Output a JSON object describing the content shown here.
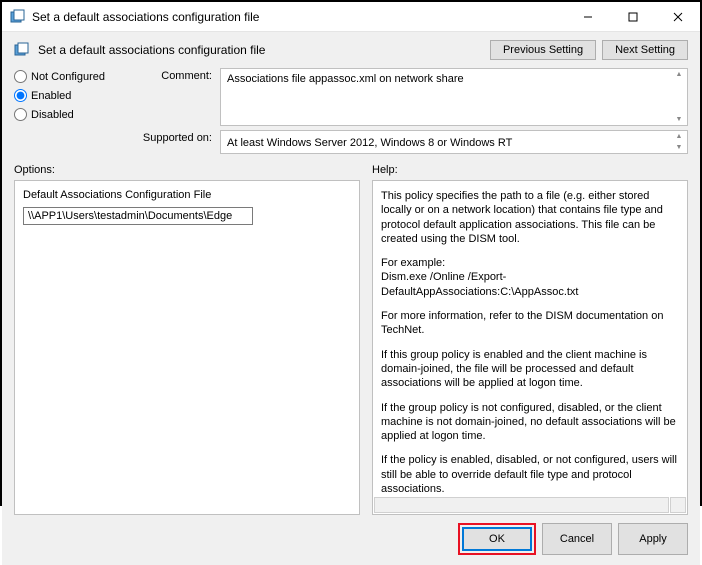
{
  "window": {
    "title": "Set a default associations configuration file"
  },
  "header": {
    "title": "Set a default associations configuration file",
    "prev_button": "Previous Setting",
    "next_button": "Next Setting"
  },
  "state": {
    "not_configured": "Not Configured",
    "enabled": "Enabled",
    "disabled": "Disabled",
    "selected": "enabled"
  },
  "fields": {
    "comment_label": "Comment:",
    "comment_value": "Associations file appassoc.xml on network share",
    "supported_label": "Supported on:",
    "supported_value": "At least Windows Server 2012, Windows 8 or Windows RT"
  },
  "options": {
    "section_label": "Options:",
    "field_label": "Default Associations Configuration File",
    "field_value": "\\\\APP1\\Users\\testadmin\\Documents\\Edge"
  },
  "help": {
    "section_label": "Help:",
    "p1": "This policy specifies the path to a file (e.g. either stored locally or on a network location) that contains file type and protocol default application associations. This file can be created using the DISM tool.",
    "p2a": "For example:",
    "p2b": "Dism.exe /Online /Export-DefaultAppAssociations:C:\\AppAssoc.txt",
    "p3": "For more information, refer to the DISM documentation on TechNet.",
    "p4": "If this group policy is enabled and the client machine is domain-joined, the file will be processed and default associations will be applied at logon time.",
    "p5": "If the group policy is not configured, disabled, or the client machine is not domain-joined, no default associations will be applied at logon time.",
    "p6": "If the policy is enabled, disabled, or not configured, users will still be able to override default file type and protocol associations."
  },
  "footer": {
    "ok": "OK",
    "cancel": "Cancel",
    "apply": "Apply"
  }
}
